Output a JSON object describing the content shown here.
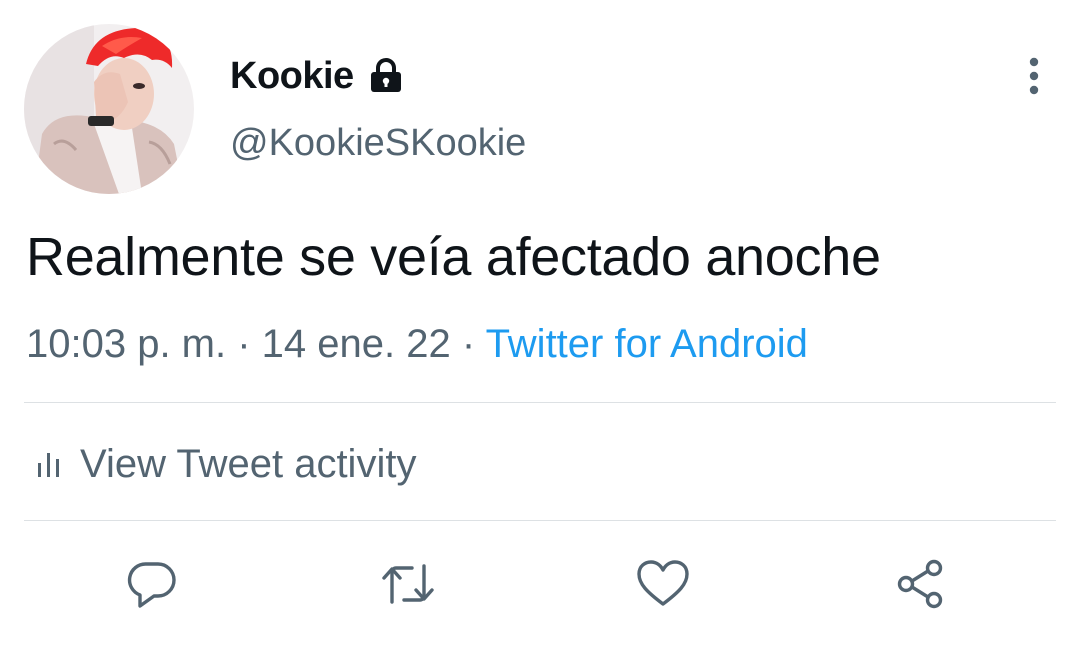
{
  "tweet": {
    "display_name": "Kookie",
    "handle": "@KookieSKookie",
    "text": "Realmente se veía afectado anoche",
    "time": "10:03 p. m.",
    "separator": " · ",
    "date": "14 ene. 22",
    "source": "Twitter for Android",
    "activity_label": "View Tweet activity"
  },
  "icons": {
    "lock": "lock-icon",
    "more": "more-vertical-icon",
    "activity": "bar-chart-icon",
    "reply": "reply-icon",
    "retweet": "retweet-icon",
    "like": "heart-icon",
    "share": "share-icon"
  },
  "colors": {
    "text": "#0f1419",
    "secondary": "#536471",
    "link": "#1d9bf0",
    "divider": "#dde1e4"
  }
}
